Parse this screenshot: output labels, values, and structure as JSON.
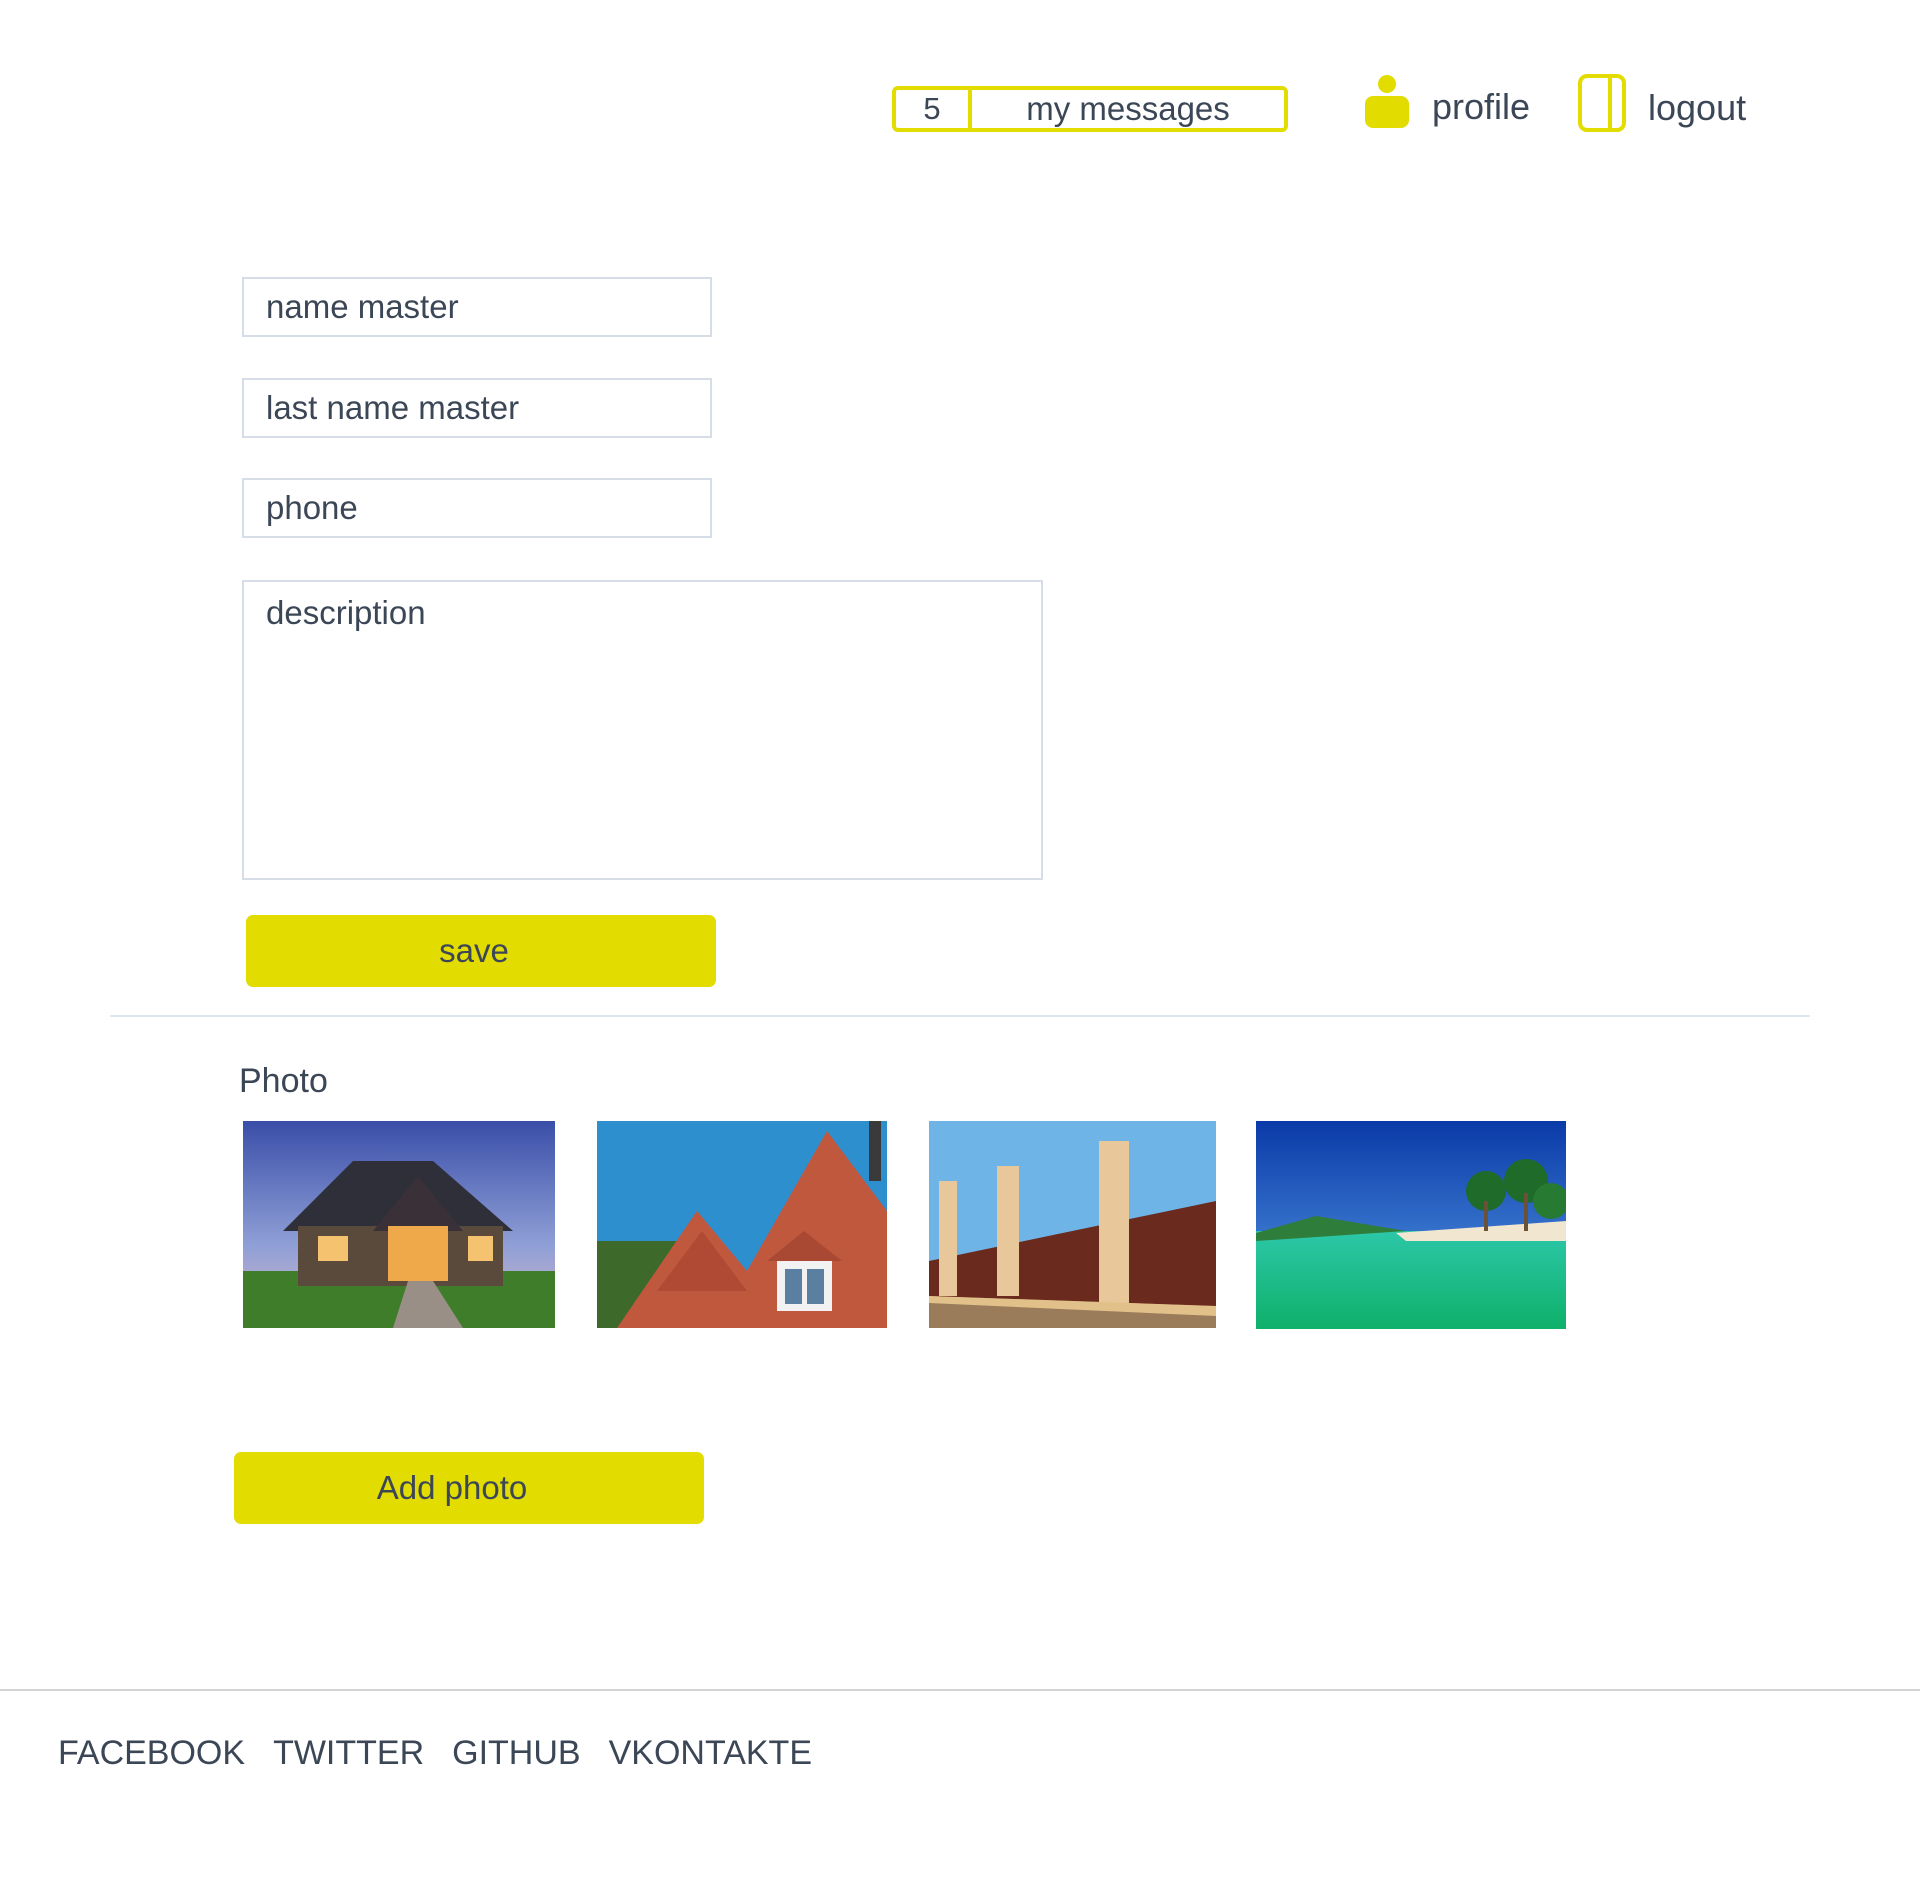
{
  "header": {
    "message_count": "5",
    "messages_label": "my messages",
    "profile_label": "profile",
    "logout_label": "logout",
    "accent_color": "#e3dc00"
  },
  "form": {
    "name_placeholder": "name master",
    "last_name_placeholder": "last name master",
    "phone_placeholder": "phone",
    "description_placeholder": "description",
    "save_label": "save"
  },
  "photos": {
    "heading": "Photo",
    "items": [
      {
        "icon": "house-photo"
      },
      {
        "icon": "roof-photo"
      },
      {
        "icon": "fence-photo"
      },
      {
        "icon": "beach-photo"
      }
    ],
    "add_label": "Add photo"
  },
  "footer": {
    "links": [
      "FACEBOOK",
      "TWITTER",
      "GITHUB",
      "VKONTAKTE"
    ]
  }
}
